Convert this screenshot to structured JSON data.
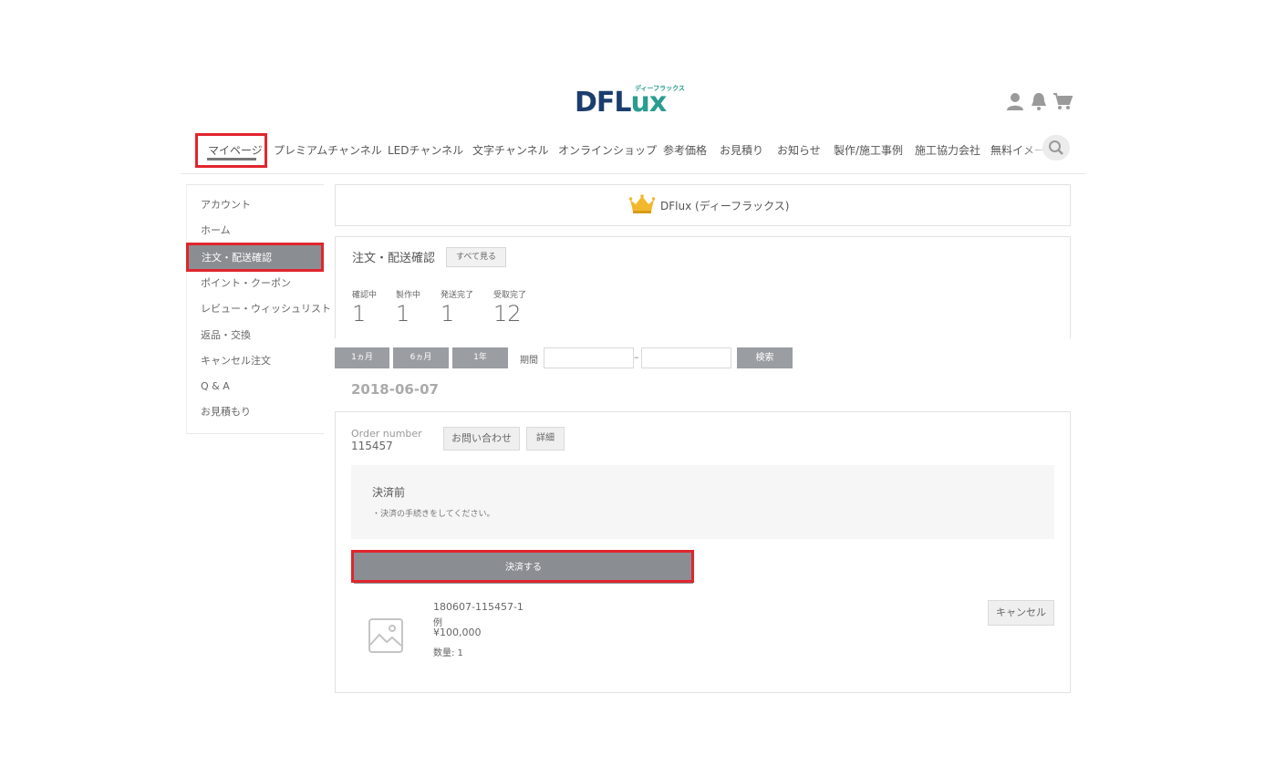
{
  "header": {
    "logo_main_prefix": "DFL",
    "logo_main_suffix": "ux",
    "logo_sub": "ディーフラックス",
    "icons": [
      "user-icon",
      "bell-icon",
      "cart-icon"
    ]
  },
  "nav": {
    "items": [
      "マイページ",
      "プレミアムチャンネル",
      "LEDチャンネル",
      "文字チャンネル",
      "オンラインショップ",
      "参考価格",
      "お見積り",
      "お知らせ",
      "製作/施工事例",
      "施工協力会社",
      "無料イメージ"
    ],
    "active_index": 0
  },
  "sidebar": {
    "items": [
      "アカウント",
      "ホーム",
      "注文・配送確認",
      "ポイント・クーポン",
      "レビュー・ウィッシュリスト",
      "返品・交換",
      "キャンセル注文",
      "Q & A",
      "お見積もり"
    ],
    "active_index": 2
  },
  "rank": {
    "text": "DFlux (ディーフラックス)"
  },
  "order_summary": {
    "title": "注文・配送確認",
    "view_all": "すべて見る",
    "stats": [
      {
        "label": "確認中",
        "value": "1"
      },
      {
        "label": "製作中",
        "value": "1"
      },
      {
        "label": "発送完了",
        "value": "1"
      },
      {
        "label": "受取完了",
        "value": "12"
      }
    ]
  },
  "filter": {
    "buttons": [
      "1ヵ月",
      "6ヵ月",
      "1年"
    ],
    "period_label": "期間",
    "date_from": "",
    "date_to": "",
    "separator": "–",
    "search": "検索"
  },
  "order": {
    "date": "2018-06-07",
    "number_label": "Order number",
    "number": "115457",
    "inquiry": "お問い合わせ",
    "detail": "詳細",
    "status_title": "決済前",
    "status_note": "・決済の手続きをしてください。",
    "pay_button": "決済する",
    "item": {
      "code": "180607-115457-1",
      "name": "例",
      "price": "¥100,000",
      "qty": "数量: 1",
      "cancel": "キャンセル"
    }
  },
  "colors": {
    "highlight": "#e0252d",
    "active_bg": "#8a8d92",
    "brand_dark": "#1c3d6e",
    "brand_accent": "#2a9d8f"
  }
}
